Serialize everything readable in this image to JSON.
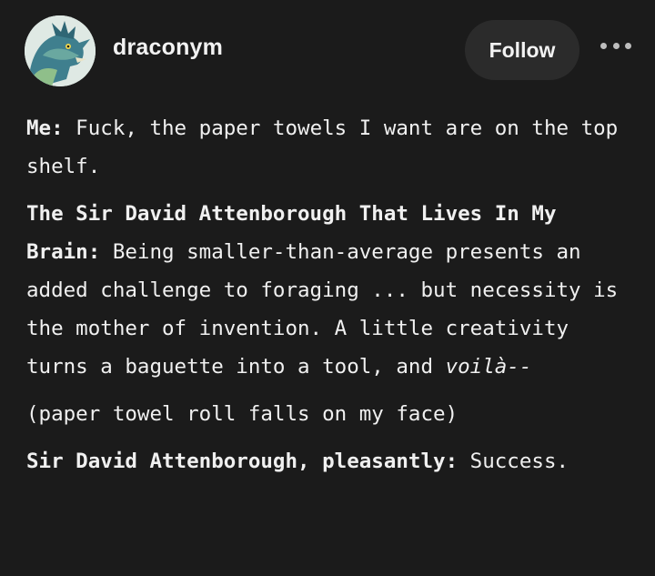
{
  "post": {
    "author": "draconym",
    "follow_label": "Follow",
    "more_icon": "more-horizontal-icon",
    "avatar_icon": "dragon-avatar"
  },
  "body": [
    {
      "speaker": "Me:",
      "text": " Fuck, the paper towels I want are on the top shelf."
    },
    {
      "speaker": "The Sir David Attenborough That Lives In My Brain:",
      "text": " Being smaller-than-average presents an added challenge to foraging ... but necessity is the mother of invention. A little creativity turns a baguette into a tool, and ",
      "emphasis": "voilà--"
    },
    {
      "text": "(paper towel roll falls on my face)"
    },
    {
      "speaker": "Sir David Attenborough, pleasantly:",
      "text": " Success."
    }
  ],
  "colors": {
    "background": "#1b1b1b",
    "text": "#f0f0f0",
    "button_bg": "#2b2b2b"
  }
}
